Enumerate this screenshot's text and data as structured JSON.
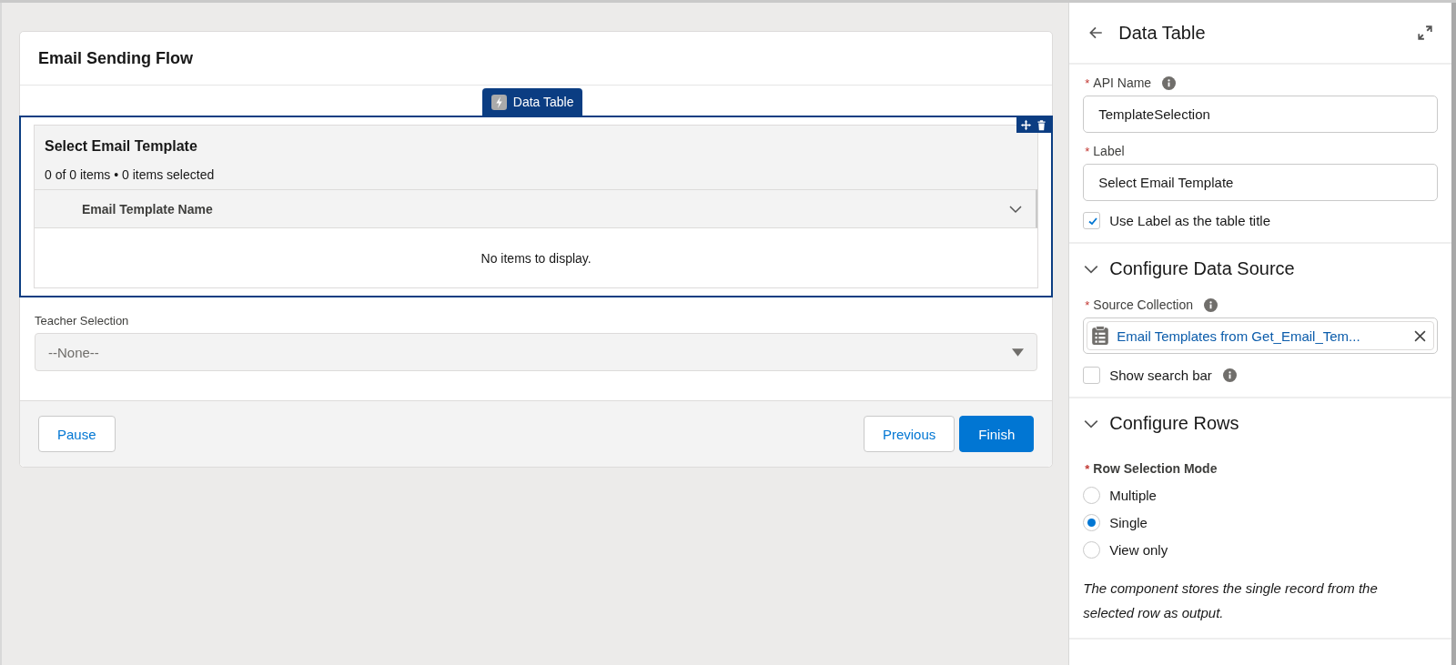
{
  "flow": {
    "title": "Email Sending Flow",
    "component_tab": {
      "label": "Data Table"
    },
    "table": {
      "title": "Select Email Template",
      "summary": "0 of 0 items • 0 items selected",
      "columns": [
        {
          "label": "Email Template Name"
        }
      ],
      "empty_message": "No items to display."
    },
    "picklist": {
      "label": "Teacher Selection",
      "value": "--None--"
    },
    "buttons": [
      {
        "label": "Pause",
        "kind": "neutral"
      },
      {
        "label": "Previous",
        "kind": "neutral"
      },
      {
        "label": "Finish",
        "kind": "brand"
      }
    ]
  },
  "properties_panel": {
    "title": "Data Table",
    "api_name": {
      "label": "API Name",
      "required_mark": "*",
      "value": "TemplateSelection"
    },
    "label_field": {
      "label": "Label",
      "required_mark": "*",
      "value": "Select Email Template"
    },
    "use_label_checkbox": {
      "label": "Use Label as the table title",
      "checked": true
    },
    "sections": [
      {
        "title": "Configure Data Source",
        "expanded": true,
        "source_collection": {
          "label": "Source Collection",
          "required_mark": "*",
          "pill": "Email Templates from Get_Email_Tem..."
        },
        "search_checkbox": {
          "label": "Show search bar",
          "checked": false
        }
      },
      {
        "title": "Configure Rows",
        "expanded": true,
        "radio_group": {
          "label": "Row Selection Mode",
          "required_mark": "*",
          "options": [
            {
              "label": "Multiple",
              "selected": false
            },
            {
              "label": "Single",
              "selected": true
            },
            {
              "label": "View only",
              "selected": false
            }
          ]
        },
        "help_text": "The component stores the single record from the selected row as output."
      }
    ]
  }
}
